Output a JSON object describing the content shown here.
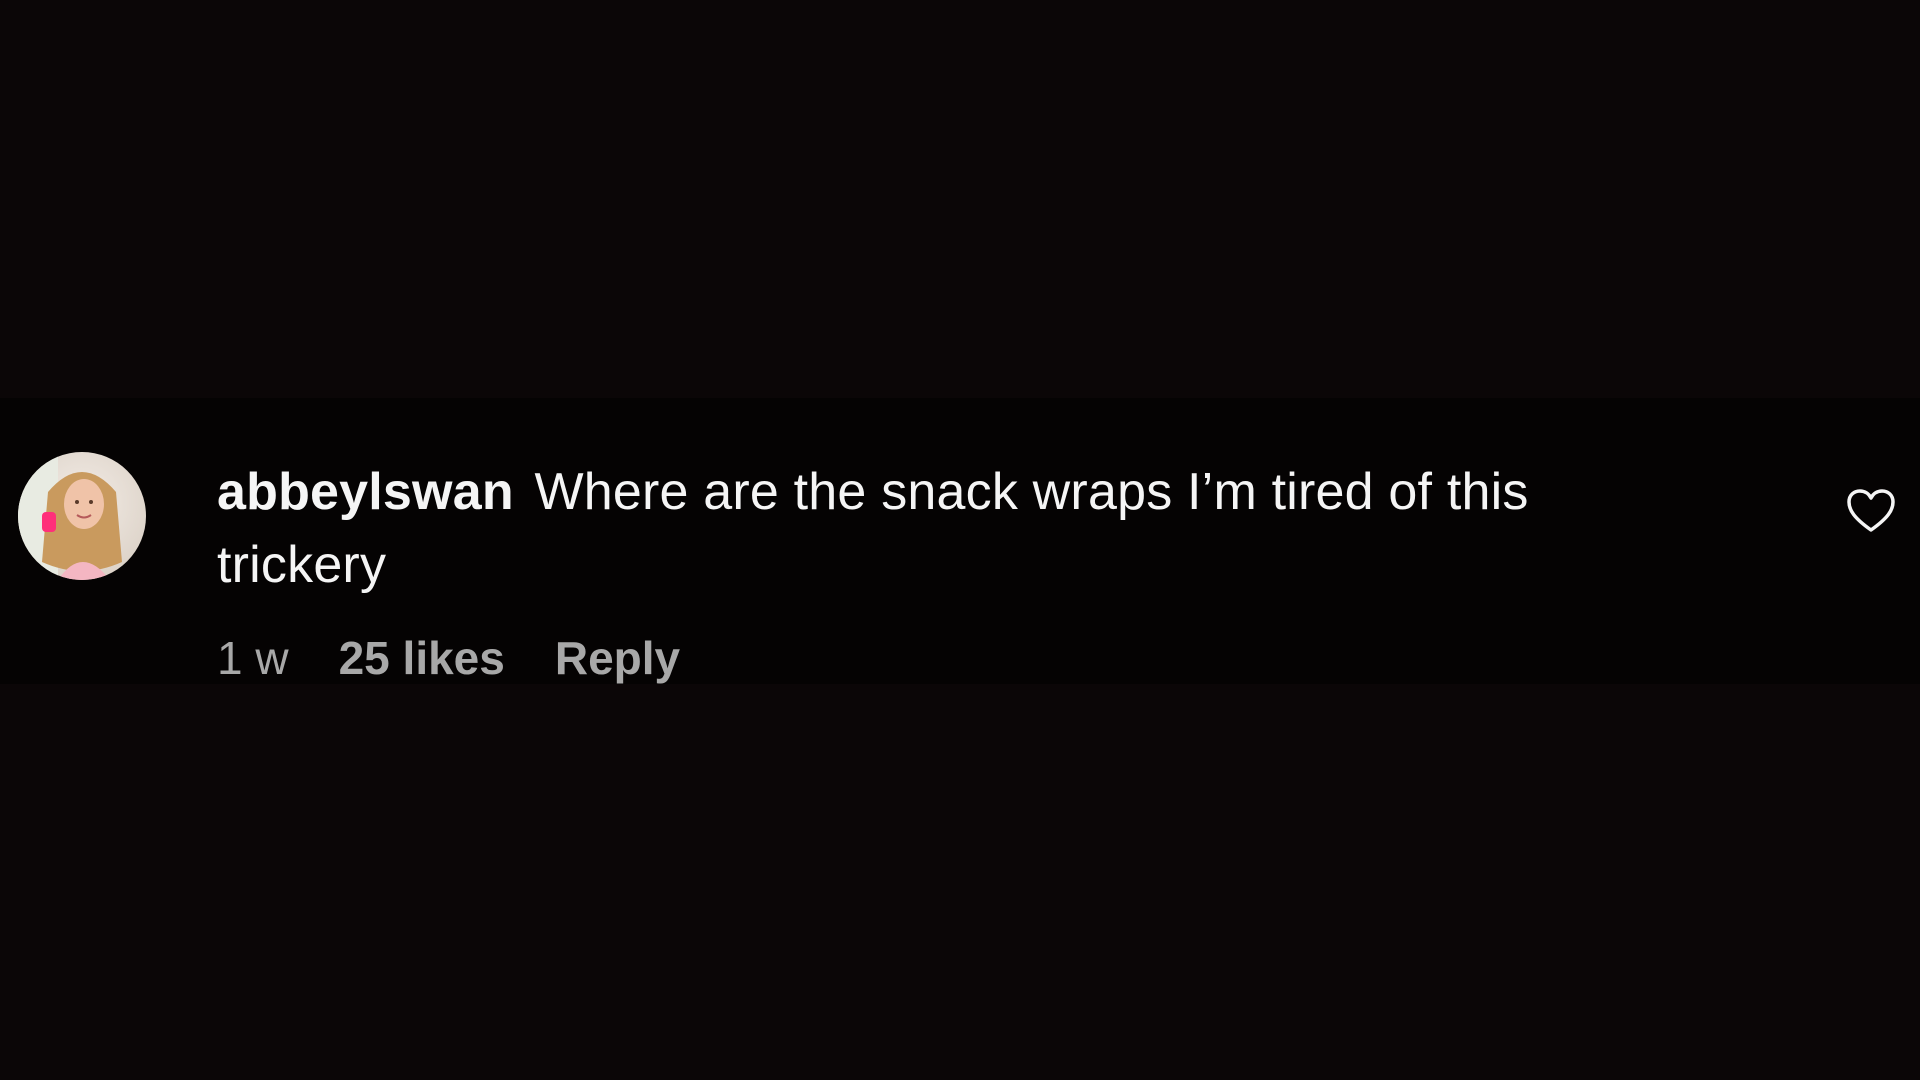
{
  "comment": {
    "username": "abbeylswan",
    "text": "Where are the snack wraps I’m tired of this trickery",
    "time": "1 w",
    "likes": "25 likes",
    "reply_label": "Reply"
  },
  "icons": {
    "like": "heart-outline-icon"
  },
  "colors": {
    "background": "#0b0607",
    "comment_text": "#f5f5f5",
    "meta_text": "#a8a8a8"
  }
}
